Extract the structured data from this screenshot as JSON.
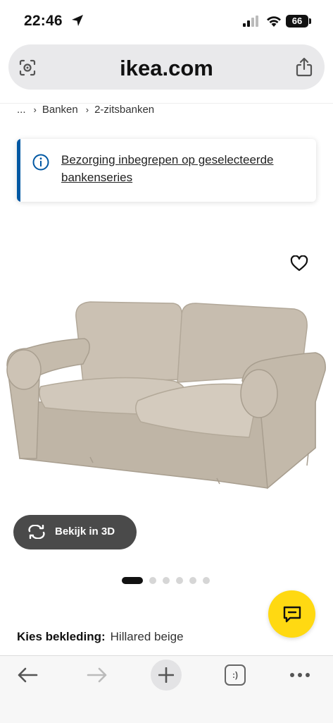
{
  "status_bar": {
    "time": "22:46",
    "battery": "66"
  },
  "browser": {
    "url": "ikea.com"
  },
  "breadcrumb": {
    "ellipsis": "...",
    "items": [
      "Banken",
      "2-zitsbanken"
    ]
  },
  "banner": {
    "text": "Bezorging inbegrepen op geselecteerde bankenseries"
  },
  "product": {
    "view_3d_label": "Bekijk in 3D",
    "image_count": 6,
    "active_image_index": 0,
    "fabric_label": "Kies bekleding:",
    "fabric_value": "Hillared beige"
  },
  "toolbar": {
    "tabs_label": ":)"
  },
  "colors": {
    "ikea_blue": "#0058a3",
    "ikea_yellow": "#ffd912",
    "sofa_beige": "#c9bfb1"
  }
}
